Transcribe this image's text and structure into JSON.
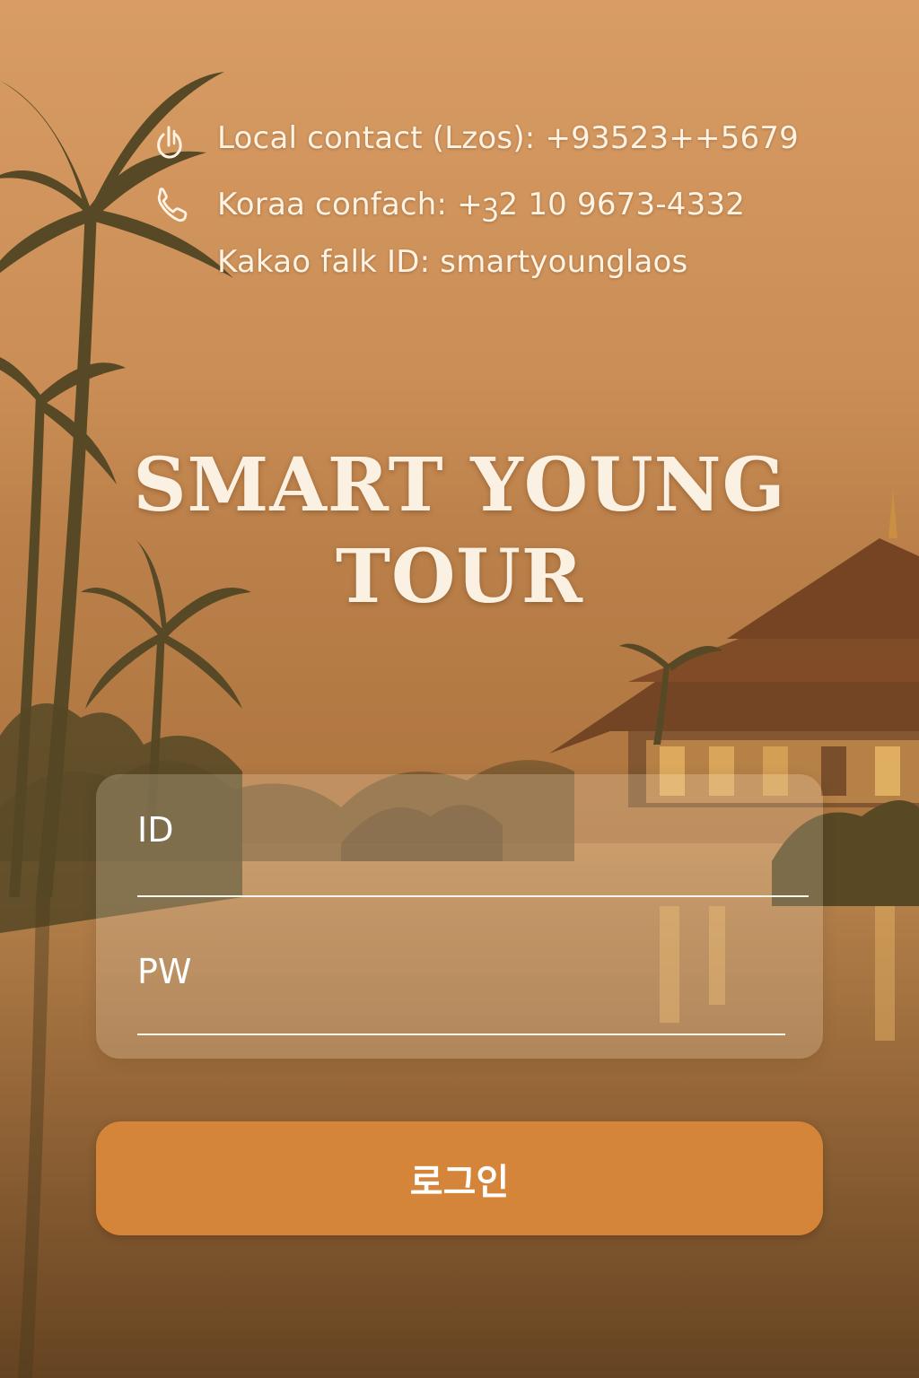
{
  "contact": {
    "local_icon": "power-plug-icon",
    "local_text": "Local contact (Lzos): +93523++5679",
    "korea_icon": "phone-icon",
    "korea_text": "Koraa confach: +ꝫ2 10   9673-4332",
    "kakao_text": "Kakao falk ID: smartyounglaos"
  },
  "brand": {
    "line1": "SMART YOUNG",
    "line2": "TOUR"
  },
  "login": {
    "id_label": "ID",
    "pw_label": "PW",
    "button_label": "로그인"
  },
  "colors": {
    "accent": "#d5853a",
    "text": "#fff3e3"
  }
}
